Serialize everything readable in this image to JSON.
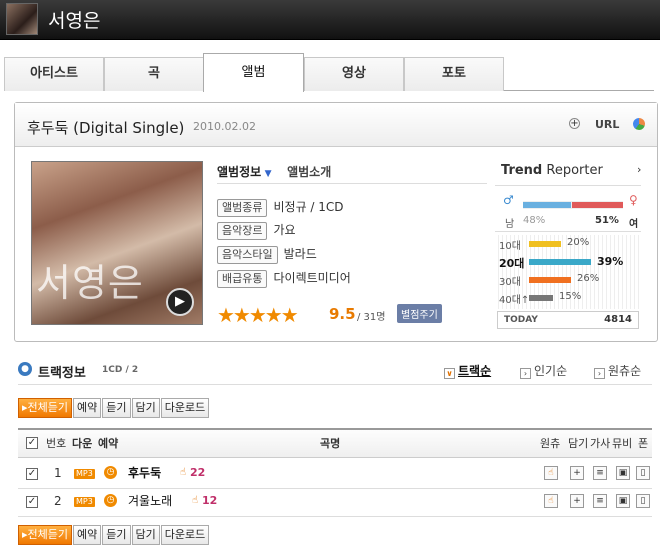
{
  "artist": {
    "name": "서영은"
  },
  "tabs": [
    "아티스트",
    "곡",
    "앨범",
    "영상",
    "포토"
  ],
  "active_tab": 2,
  "album": {
    "title": "후두둑 (Digital Single)",
    "date": "2010.02.02",
    "url_label": "URL",
    "cover_text": "서영은"
  },
  "info_tabs": {
    "info": "앨범정보",
    "intro": "앨범소개"
  },
  "details": [
    {
      "key": "앨범종류",
      "value": "비정규 / 1CD"
    },
    {
      "key": "음악장르",
      "value": "가요"
    },
    {
      "key": "음악스타일",
      "value": "발라드"
    },
    {
      "key": "배급유통",
      "value": "다이렉트미디어"
    }
  ],
  "rating": {
    "stars": "★★★★★",
    "score": "9.5",
    "count": "/ 31명",
    "button": "별점주기"
  },
  "trend": {
    "title_bold": "Trend",
    "title_rest": " Reporter",
    "male_label": "남",
    "male_pct": "48%",
    "female_label": "여",
    "female_pct": "51%",
    "male_value": 48,
    "female_value": 51,
    "ages": [
      {
        "label": "10대",
        "pct": "20%",
        "value": 20,
        "color": "#f0c020"
      },
      {
        "label": "20대",
        "pct": "39%",
        "value": 39,
        "color": "#3aa8c8"
      },
      {
        "label": "30대",
        "pct": "26%",
        "value": 26,
        "color": "#f07020"
      },
      {
        "label": "40대↑",
        "pct": "15%",
        "value": 15,
        "color": "#777777"
      }
    ],
    "today_label": "TODAY",
    "today_value": "4814"
  },
  "tracks_section": {
    "title": "트랙정보",
    "cd": "1CD / 2",
    "orders": [
      "트랙순",
      "인기순",
      "원츄순"
    ]
  },
  "buttons": [
    "전체듣기",
    "예약",
    "듣기",
    "담기",
    "다운로드"
  ],
  "table_head": {
    "no": "번호",
    "down": "다운",
    "reserve": "예약",
    "song": "곡명",
    "wonchu": "원츄",
    "add": "담기",
    "lyrics": "가사",
    "mv": "뮤비",
    "phone": "폰"
  },
  "tracks": [
    {
      "no": "1",
      "title": "후두둑",
      "likes": "22"
    },
    {
      "no": "2",
      "title": "겨울노래",
      "likes": "12"
    }
  ]
}
